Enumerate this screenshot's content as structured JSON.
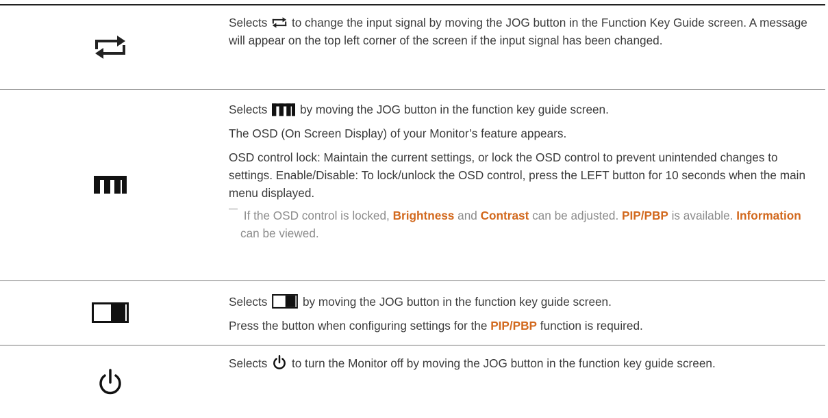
{
  "rows": [
    {
      "icon": "input-source-arrows-icon",
      "paragraphs": {
        "p1_pre": "Selects",
        "p1_post": "to change the input signal by moving the JOG button in the Function Key Guide screen. A message will appear on the top left corner of the screen if the input signal has been changed."
      }
    },
    {
      "icon": "menu-grid-icon",
      "paragraphs": {
        "p1_pre": "Selects",
        "p1_post": "by moving the JOG button in the function key guide screen.",
        "p2": "The OSD (On Screen Display) of your Monitor’s feature appears.",
        "p3": "OSD control lock: Maintain the current settings, or lock the OSD control to prevent unintended changes to settings. Enable/Disable: To lock/unlock the OSD control, press the LEFT button for 10 seconds when the main menu displayed."
      },
      "note": {
        "t1": "If the OSD control is locked,",
        "h1": "Brightness",
        "t2": "and",
        "h2": "Contrast",
        "t3": "can be adjusted.",
        "h3": "PIP/PBP",
        "t4": "is available.",
        "h4": "Information",
        "t5": "can be viewed."
      }
    },
    {
      "icon": "pip-pbp-icon",
      "paragraphs": {
        "p1_pre": "Selects",
        "p1_post": "by moving the JOG button in the function key guide screen.",
        "p2_pre": "Press the button when configuring settings for the",
        "p2_hl": "PIP/PBP",
        "p2_post": "function is required."
      }
    },
    {
      "icon": "power-icon",
      "paragraphs": {
        "p1_pre": "Selects",
        "p1_post": "to turn the Monitor off by moving the JOG button in the function key guide screen."
      }
    }
  ],
  "colors": {
    "highlight": "#d2691e",
    "text": "#3b3b3b",
    "note": "#8c8c8c"
  }
}
